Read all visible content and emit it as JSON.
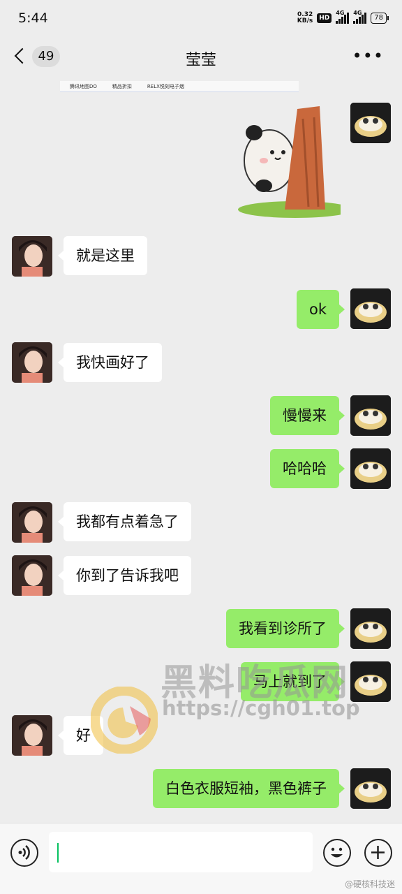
{
  "status_bar": {
    "time": "5:44",
    "net_speed_value": "0.32",
    "net_speed_unit": "KB/s",
    "hd_badge": "HD",
    "sim1": "4G",
    "sim2": "4G",
    "battery": "78"
  },
  "header": {
    "unread_count": "49",
    "title": "莹莹",
    "more_icon": "more-dots-icon"
  },
  "shared_strip": [
    "腾讯地图DO",
    "精品折扣",
    "RELX悦刻电子烟"
  ],
  "messages": [
    {
      "side": "received",
      "text": "就是这里"
    },
    {
      "side": "sent",
      "text": "ok"
    },
    {
      "side": "received",
      "text": "我快画好了"
    },
    {
      "side": "sent",
      "text": "慢慢来"
    },
    {
      "side": "sent",
      "text": "哈哈哈"
    },
    {
      "side": "received",
      "text": "我都有点着急了"
    },
    {
      "side": "received",
      "text": "你到了告诉我吧"
    },
    {
      "side": "sent",
      "text": "我看到诊所了"
    },
    {
      "side": "sent",
      "text": "马上就到了"
    },
    {
      "side": "received",
      "text": "好"
    },
    {
      "side": "sent",
      "text": "白色衣服短袖，黑色裤子"
    }
  ],
  "watermark": {
    "title": "黑料吃瓜网",
    "url": "https://cgh01.top"
  },
  "footer_mark": "@硬核科技迷",
  "colors": {
    "background": "#ededed",
    "sent_bubble": "#95ec69",
    "received_bubble": "#ffffff",
    "input_caret": "#07c160"
  }
}
